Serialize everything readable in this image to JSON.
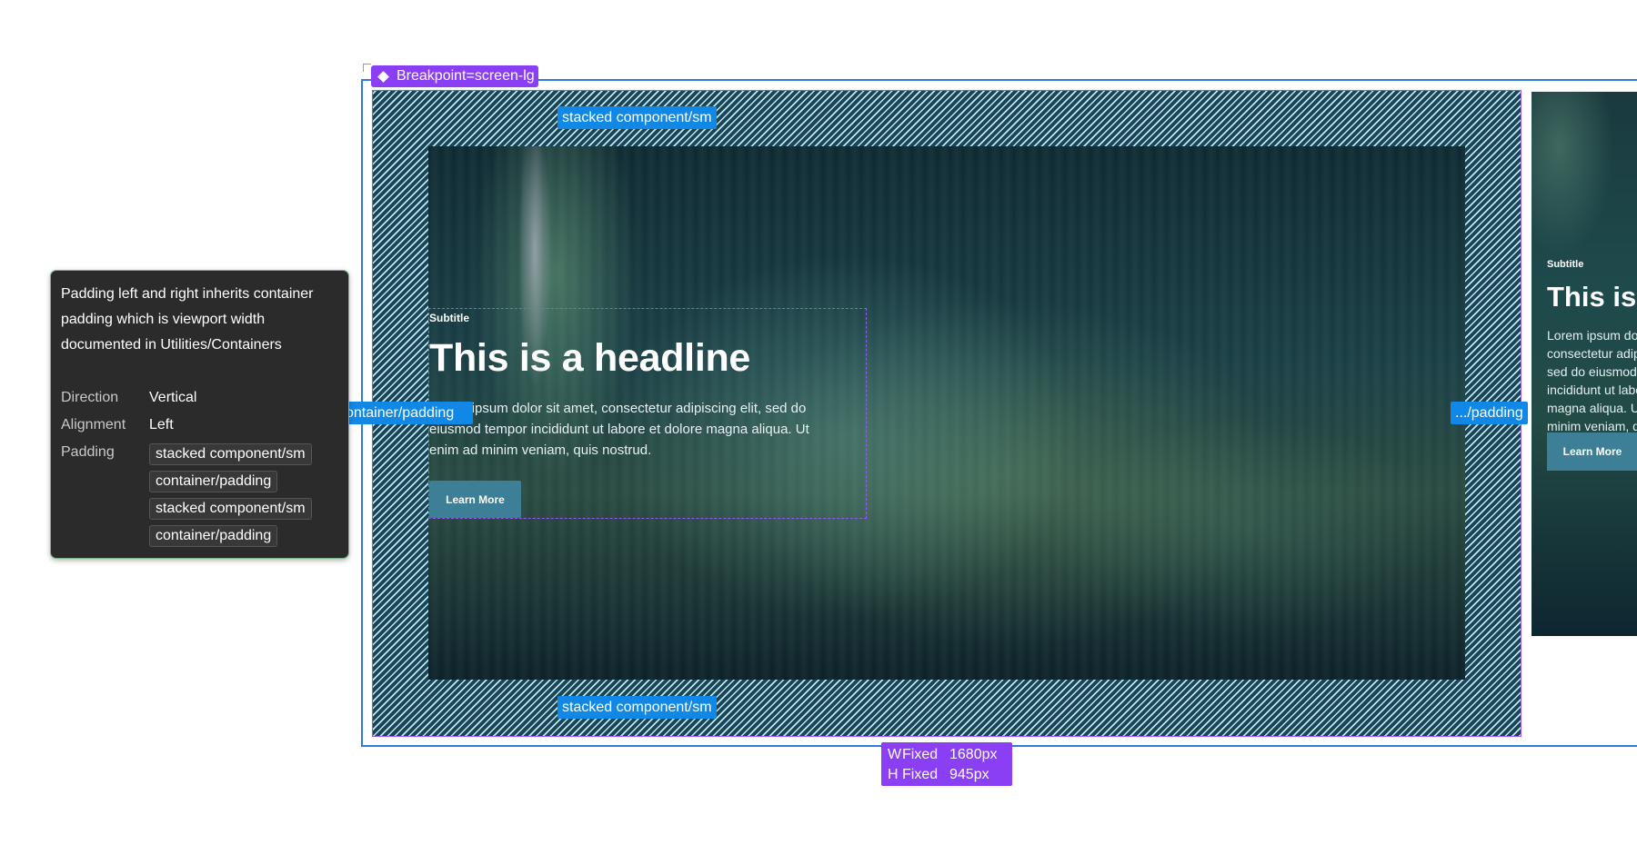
{
  "frame": {
    "breakpoint_tag": "Breakpoint=screen-lg"
  },
  "spacing_labels": {
    "top": "stacked component/sm",
    "bottom": "stacked component/sm",
    "left": "container/padding",
    "right": ".../padding"
  },
  "hero": {
    "subtitle": "Subtitle",
    "headline": "This is a headline",
    "body": "Lorem ipsum dolor sit amet, consectetur adipiscing elit, sed do eiusmod tempor incididunt ut labore et dolore magna aliqua. Ut enim ad minim veniam, quis nostrud.",
    "button_label": "Learn More"
  },
  "hero_mobile": {
    "subtitle": "Subtitle",
    "headline": "This is",
    "body": "Lorem ipsum dolor sit amet, consectetur adipiscing elit, sed do eiusmod tempor incididunt ut labore et dolore magna aliqua. Ut enim ad minim veniam, quis nostrud.",
    "button_label": "Learn More"
  },
  "dimensions": {
    "width_axis": "W",
    "width_mode": "Fixed",
    "width_value": "1680px",
    "height_axis": "H",
    "height_mode": "Fixed",
    "height_value": "945px"
  },
  "inspector": {
    "description": "Padding left and right inherits container padding which is viewport width documented in Utilities/Containers",
    "direction_label": "Direction",
    "direction_value": "Vertical",
    "alignment_label": "Alignment",
    "alignment_value": "Left",
    "padding_label": "Padding",
    "padding_values": [
      "stacked component/sm",
      "container/padding",
      "stacked component/sm",
      "container/padding"
    ]
  },
  "colors": {
    "selection_purple": "#8a3ff5",
    "spacing_blue": "#1188e6",
    "frame_blue": "#2f7bd8",
    "button_teal": "#3d7f96"
  },
  "icons": {
    "breakpoint_tag": "component-diamond-icon"
  }
}
